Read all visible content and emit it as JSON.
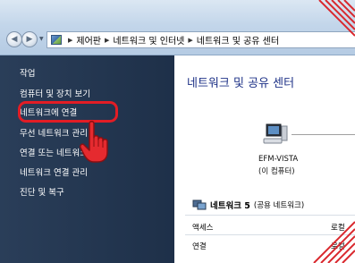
{
  "breadcrumb": {
    "items": [
      "제어판",
      "네트워크 및 인터넷",
      "네트워크 및 공유 센터"
    ]
  },
  "sidebar": {
    "title": "작업",
    "items": [
      {
        "label": "컴퓨터 및 장치 보기"
      },
      {
        "label": "네트워크에 연결"
      },
      {
        "label": "무선 네트워크 관리"
      },
      {
        "label": "연결 또는 네트워크 설정"
      },
      {
        "label": "네트워크 연결 관리"
      },
      {
        "label": "진단 및 복구"
      }
    ],
    "highlighted_index": 1
  },
  "main": {
    "title": "네트워크 및 공유 센터",
    "computer": {
      "name": "EFM-VISTA",
      "subtitle": "(이 컴퓨터)"
    },
    "network": {
      "name": "네트워크 5",
      "type": "(공용 네트워크)"
    },
    "details": [
      {
        "key": "액세스",
        "value": "로컬"
      },
      {
        "key": "연결",
        "value": "로컬"
      }
    ]
  },
  "colors": {
    "sidebar_bg": "#233650",
    "highlight": "#e21d25",
    "title_text": "#1e3287"
  }
}
